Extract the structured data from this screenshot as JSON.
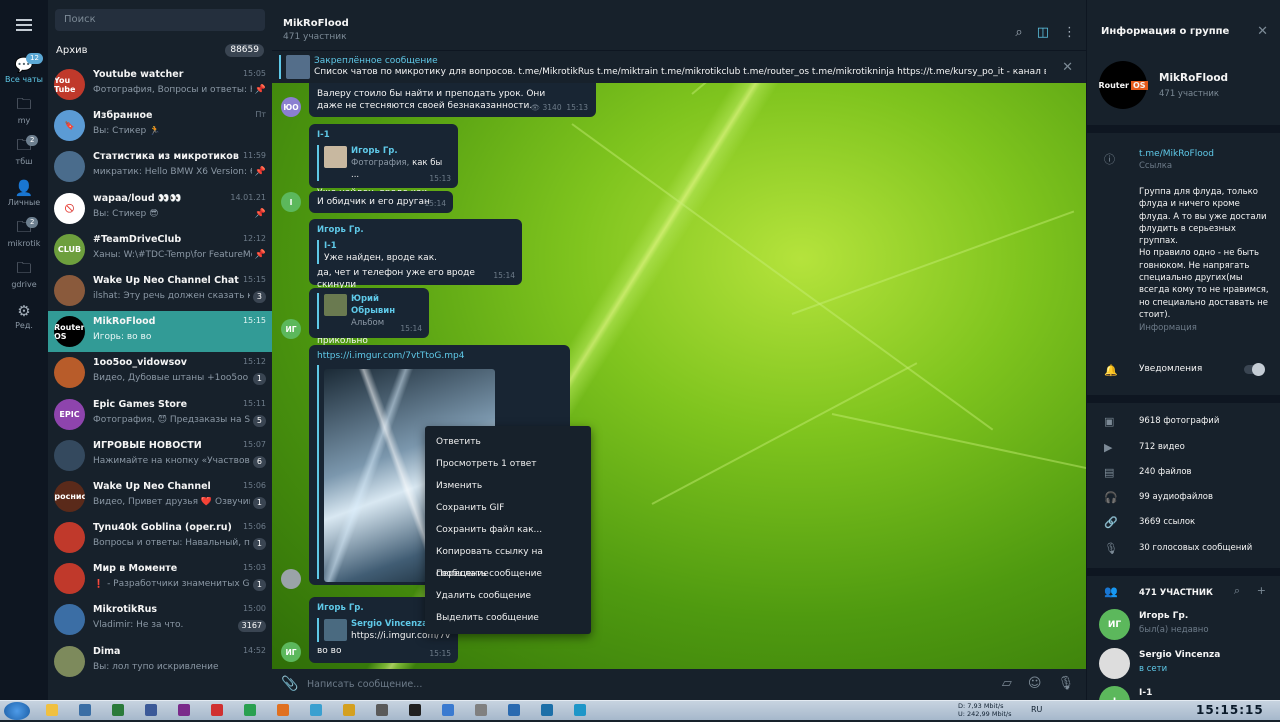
{
  "rail": {
    "folders": [
      {
        "label": "Все чаты",
        "badge": "12",
        "icon": "chat-bubbles-icon",
        "active": true
      },
      {
        "label": "my",
        "badge": "",
        "icon": "folder-icon"
      },
      {
        "label": "тбш",
        "badge": "2",
        "icon": "folder-icon"
      },
      {
        "label": "Личные",
        "badge": "",
        "icon": "person-icon"
      },
      {
        "label": "mikrotik",
        "badge": "2",
        "icon": "folder-icon"
      },
      {
        "label": "gdrive",
        "badge": "",
        "icon": "folder-icon"
      },
      {
        "label": "Ред.",
        "badge": "",
        "icon": "sliders-icon"
      }
    ]
  },
  "sidebar": {
    "search_placeholder": "Поиск",
    "archive_label": "Архив",
    "archive_count": "88659",
    "chats": [
      {
        "name": "Youtube watcher",
        "time": "15:05",
        "preview": "Фотография, Вопросы и ответы: На...",
        "unread": "",
        "pin": "📌",
        "avatar_text": "You Tube",
        "avatar_color": "#c0392b"
      },
      {
        "name": "Избранное",
        "time": "Пт",
        "preview": "Вы: Стикер 🏃",
        "unread": "",
        "pin": "",
        "avatar_text": "🔖",
        "avatar_color": "#5b9bd5"
      },
      {
        "name": "Статистика из микротиков",
        "time": "11:59",
        "preview": "микратик: Hello BMW X6 Version: 6.4...",
        "unread": "",
        "pin": "📌",
        "avatar_text": "",
        "avatar_color": "#4a6c8c"
      },
      {
        "name": "wapaa/loud 👀👀",
        "time": "14.01.21",
        "preview": "Вы: Стикер 😎",
        "unread": "",
        "pin": "📌",
        "avatar_text": "🚫",
        "avatar_color": "#ffffff"
      },
      {
        "name": "#TeamDriveClub",
        "time": "12:12",
        "preview": "Ханы: W:\\#TDC-Temp\\for FeatureMo...",
        "unread": "",
        "pin": "📌",
        "avatar_text": "CLUB",
        "avatar_color": "#6d9f3d"
      },
      {
        "name": "Wake Up Neo Channel Chat",
        "time": "15:15",
        "preview": "ilshat: Эту речь должен сказать каж...",
        "unread": "3",
        "pin": "",
        "avatar_text": "",
        "avatar_color": "#8a5a3c"
      },
      {
        "name": "MikRoFlood",
        "time": "15:15",
        "preview": "Игорь: во во",
        "unread": "",
        "pin": "",
        "avatar_text": "Router OS",
        "avatar_color": "#000000",
        "selected": true
      },
      {
        "name": "1oo5oo_vidowsov",
        "time": "15:12",
        "preview": "Видео, Дубовые штаны +1oo5oo",
        "unread": "1",
        "pin": "",
        "avatar_text": "",
        "avatar_color": "#b85c2a"
      },
      {
        "name": "Epic Games Store",
        "time": "15:11",
        "preview": "Фотография, 😈 Предзаказы на Sys...",
        "unread": "5",
        "pin": "",
        "avatar_text": "EPIC",
        "avatar_color": "#8e44ad"
      },
      {
        "name": "ИГРОВЫЕ НОВОСТИ",
        "time": "15:07",
        "preview": "Нажимайте на кнопку «Участвоват...",
        "unread": "6",
        "pin": "",
        "avatar_text": "",
        "avatar_color": "#34495e"
      },
      {
        "name": "Wake Up Neo Channel",
        "time": "15:06",
        "preview": "Видео, Привет друзья ❤️ Озвучим...",
        "unread": "1",
        "pin": "",
        "avatar_text": "Проснись",
        "avatar_color": "#5a2a1a"
      },
      {
        "name": "Tynu40k Goblina (oper.ru)",
        "time": "15:06",
        "preview": "Вопросы и ответы: Навальный, пер...",
        "unread": "1",
        "pin": "",
        "avatar_text": "",
        "avatar_color": "#c0392b"
      },
      {
        "name": "Мир в Моменте",
        "time": "15:03",
        "preview": "❗ - Разработчики знаменитых GN...",
        "unread": "1",
        "pin": "",
        "avatar_text": "",
        "avatar_color": "#c0392b"
      },
      {
        "name": "MikrotikRus",
        "time": "15:00",
        "preview": "Vladimir: Не за что.",
        "unread": "3167",
        "pin": "",
        "avatar_text": "",
        "avatar_color": "#3b6ea5"
      },
      {
        "name": "Dima",
        "time": "14:52",
        "preview": "Вы: лол тупо искривление",
        "unread": "",
        "pin": "",
        "avatar_text": "",
        "avatar_color": "#7d8a5c"
      }
    ]
  },
  "main": {
    "title": "MikRoFlood",
    "members": "471 участник",
    "pinned_label": "Закреплённое сообщение",
    "pinned_text": "Список  чатов по микротику для вопросов. t.me/MikrotikRus t.me/miktrain t.me/mikrotikclub t.me/router_os t.me/mikrotikninja https://t.me/kursy_po_it - канал ведет Дмитрий Ск...",
    "messages": {
      "m1_text": "Валеру стоило бы найти и преподать урок. Они даже не стесняются своей безнаказанности.",
      "m1_views": "👁 3140",
      "m1_time": "15:13",
      "m1_avatar": "ЮО",
      "m2_from": "I-1",
      "m2_reply_name": "Игорь Гр.",
      "m2_reply_type": "Фотография,",
      "m2_reply_text": "как бы ...",
      "m2_text": "Уже найден, вроде как.",
      "m2_time": "15:13",
      "m3_text": "И обидчик и его друган",
      "m3_time": "15:14",
      "m3_avatar": "I",
      "m4_from": "Игорь Гр.",
      "m4_reply_name": "I-1",
      "m4_reply_text": "Уже найден, вроде как.",
      "m4_text": "да, чет и телефон уже его вроде скинули",
      "m4_time": "15:14",
      "m5_reply_name": "Юрий Обрывин",
      "m5_reply_text": "Альбом",
      "m5_text": "прикольно",
      "m5_time": "15:14",
      "m5_avatar": "ИГ",
      "m6_link": "https://i.imgur.com/7vtTtoG.mp4",
      "m7_from": "Игорь Гр.",
      "m7_reply_name": "Sergio Vincenza",
      "m7_reply_text": "https://i.imgur.com/7v...",
      "m7_text": "во во",
      "m7_time": "15:15",
      "m7_avatar": "ИГ"
    },
    "context_menu": [
      "Ответить",
      "Просмотреть 1 ответ",
      "Изменить",
      "Сохранить GIF",
      "Сохранить файл как...",
      "Копировать ссылку на сообщение",
      "Переслать сообщение",
      "Удалить сообщение",
      "Выделить сообщение"
    ],
    "composer_placeholder": "Написать сообщение..."
  },
  "info": {
    "header": "Информация о группе",
    "name": "MikRoFlood",
    "members": "471 участник",
    "logo_text": "Router",
    "logo_accent": "OS",
    "link": "t.me/MikRoFlood",
    "link_label": "Ссылка",
    "description": "Группа для флуда, только флуда и ничего кроме флуда. А то вы уже достали флудить в серьезных группах.\nНо правило одно - не быть говнюком. Не напрягать специально других(мы всегда кому то не нравимся, но специально доставать не стоит).",
    "description_label": "Информация",
    "notifications": "Уведомления",
    "stats": [
      {
        "icon": "photo-icon",
        "text": "9618 фотографий"
      },
      {
        "icon": "video-icon",
        "text": "712 видео"
      },
      {
        "icon": "file-icon",
        "text": "240 файлов"
      },
      {
        "icon": "headphones-icon",
        "text": "99 аудиофайлов"
      },
      {
        "icon": "link-icon",
        "text": "3669 ссылок"
      },
      {
        "icon": "mic-icon",
        "text": "30 голосовых сообщений"
      }
    ],
    "members_header": "471 УЧАСТНИК",
    "member_list": [
      {
        "avatar": "ИГ",
        "name": "Игорь Гр.",
        "status": "был(а) недавно",
        "color": "#5cb85c",
        "online": false
      },
      {
        "avatar": "",
        "name": "Sergio Vincenza",
        "status": "в сети",
        "color": "#dddddd",
        "online": true
      },
      {
        "avatar": "I",
        "name": "I-1",
        "status": "был(а) недавно",
        "color": "#5cb85c",
        "online": false
      }
    ]
  },
  "taskbar": {
    "net_down": "7,93 Mbit/s",
    "net_up": "242,99 Mbit/s",
    "net_d_label": "D:",
    "net_u_label": "U:",
    "lang": "RU",
    "clock": "15:15:15"
  }
}
